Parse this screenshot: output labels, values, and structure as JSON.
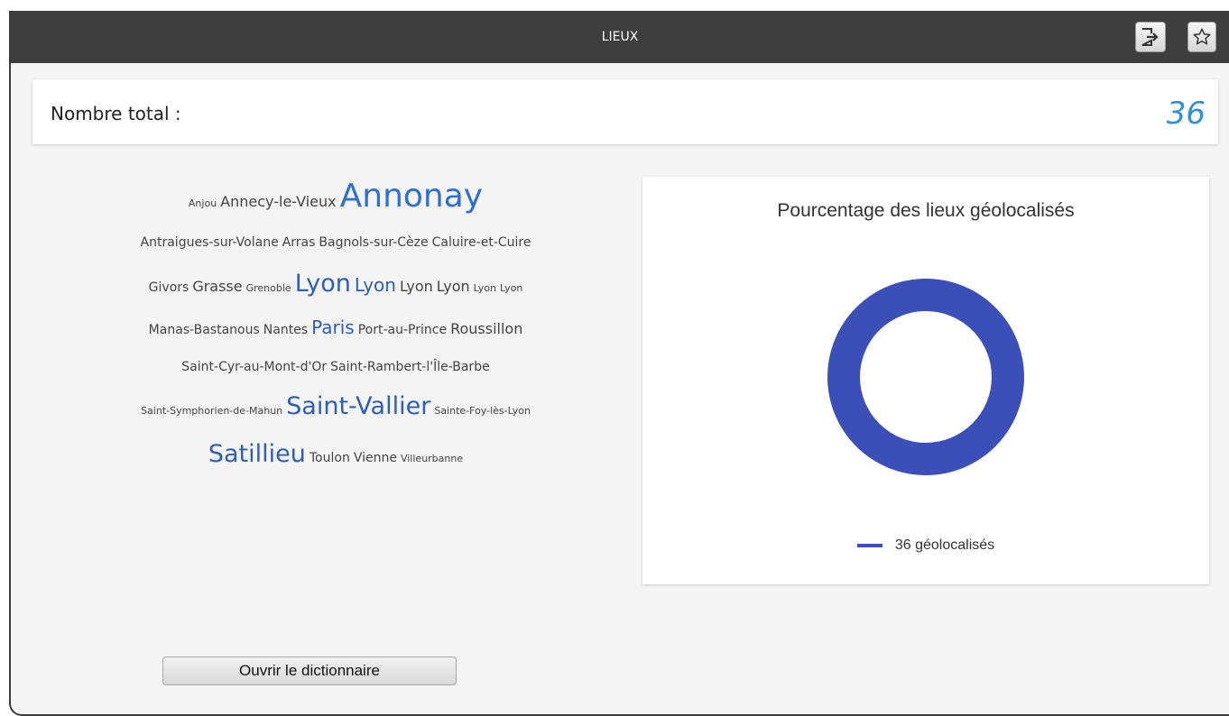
{
  "window": {
    "title": "LIEUX"
  },
  "toolbar": {
    "export_icon": "export-icon",
    "star_icon": "star-icon"
  },
  "summary": {
    "label": "Nombre total :",
    "value": "36"
  },
  "word_cloud": {
    "lines": [
      [
        {
          "text": "Anjou",
          "size": 1
        },
        {
          "text": "Annecy-le-Vieux",
          "size": 3
        },
        {
          "text": "Annonay",
          "size": 6
        }
      ],
      [
        {
          "text": "Antraigues-sur-Volane",
          "size": 2
        },
        {
          "text": "Arras",
          "size": 2
        },
        {
          "text": "Bagnols-sur-Cèze",
          "size": 2
        },
        {
          "text": "Caluire-et-Cuire",
          "size": 2
        }
      ],
      [
        {
          "text": "Givors",
          "size": 2
        },
        {
          "text": "Grasse",
          "size": 3
        },
        {
          "text": "Grenoble",
          "size": 1
        },
        {
          "text": "Lyon",
          "size": 5
        },
        {
          "text": "Lyon",
          "size": 4
        },
        {
          "text": "Lyon",
          "size": 3
        },
        {
          "text": "Lyon",
          "size": 3
        },
        {
          "text": "Lyon",
          "size": 1
        },
        {
          "text": "Lyon",
          "size": 1
        }
      ],
      [
        {
          "text": "Manas-Bastanous",
          "size": 2
        },
        {
          "text": "Nantes",
          "size": 2
        },
        {
          "text": "Paris",
          "size": 4
        },
        {
          "text": "Port-au-Prince",
          "size": 2
        },
        {
          "text": "Roussillon",
          "size": 3
        }
      ],
      [
        {
          "text": "Saint-Cyr-au-Mont-d'Or",
          "size": 2
        },
        {
          "text": "Saint-Rambert-l'Île-Barbe",
          "size": 2
        }
      ],
      [
        {
          "text": "Saint-Symphorien-de-Mahun",
          "size": 1
        },
        {
          "text": "Saint-Vallier",
          "size": 5
        },
        {
          "text": "Sainte-Foy-lès-Lyon",
          "size": 1
        }
      ],
      [
        {
          "text": "Satillieu",
          "size": 5
        },
        {
          "text": "Toulon",
          "size": 2
        },
        {
          "text": "Vienne",
          "size": 2
        },
        {
          "text": "Villeurbanne",
          "size": 1
        }
      ]
    ]
  },
  "chart_data": {
    "type": "pie",
    "title": "Pourcentage des lieux géolocalisés",
    "categories": [
      "36 géolocalisés"
    ],
    "values": [
      36
    ],
    "colors": [
      "#3c4fb8"
    ],
    "legend": "bottom"
  },
  "actions": {
    "open_dictionary": "Ouvrir le dictionnaire"
  }
}
